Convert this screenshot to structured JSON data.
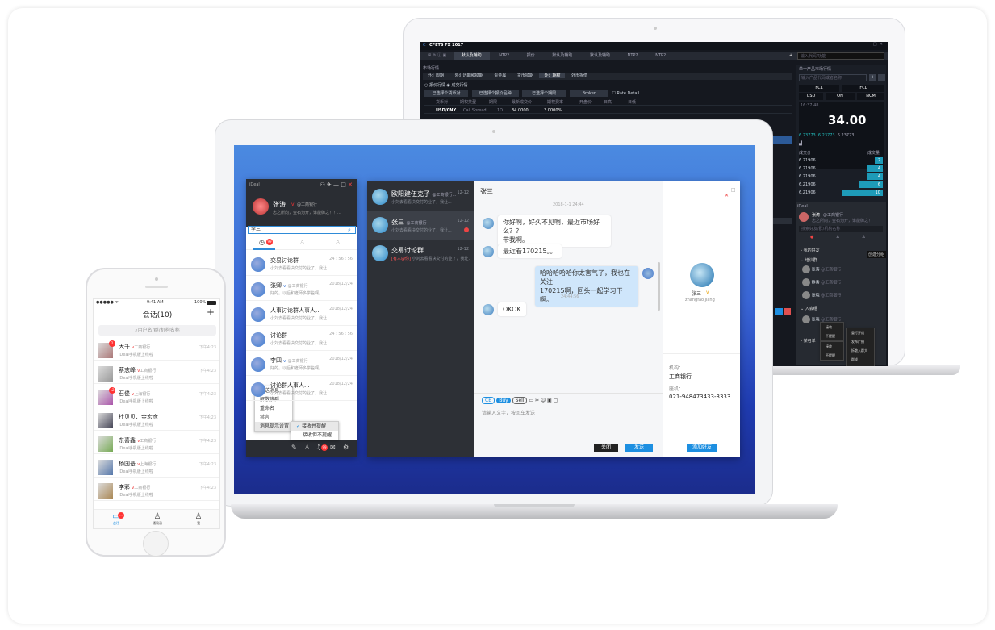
{
  "monitor": {
    "app_title": "CFETS FX 2017",
    "tabs": [
      "默认及辅助",
      "NTP2",
      "报价",
      "默认及辅助",
      "默认及辅助",
      "NTP2",
      "NTP2"
    ],
    "search_placeholder": "输入代码/功能",
    "panel_title": "市场行情",
    "sub_tabs": [
      "外汇即期",
      "外汇远期和掉期",
      "贵金属",
      "货币掉期",
      "外汇期权",
      "外币拆借"
    ],
    "radio1": "报价行情",
    "radio2": "成交行情",
    "filters": [
      "已选择个货币对",
      "已选择个报价品种",
      "已选择个期限",
      "Broker",
      "Rate Detail"
    ],
    "col_headers": [
      "货币对",
      "期权类型",
      "期限",
      "最新成交价",
      "期权费率",
      "开盘价",
      "日高",
      "日低"
    ],
    "row1": [
      "USD/CNY",
      "Call Spread",
      "1D",
      "34.0000",
      "3.0000%"
    ],
    "right_title": "单一产品市场行情",
    "right_search": "输入产品代码或者名称",
    "fcl": "FCL",
    "fcl2": "FCL",
    "usd": "USD",
    "on": "ON",
    "ncm": "NCM",
    "time": "16:37:48",
    "price": "34.00",
    "lo": "6.23773",
    "mid": "6.23773",
    "hi": "6.23773",
    "deal_price": "成交价",
    "deal_vol": "成交量",
    "orders": [
      {
        "p": "6.21906",
        "q": "2",
        "w": 0.2
      },
      {
        "p": "6.21906",
        "q": "4",
        "w": 0.4
      },
      {
        "p": "6.21906",
        "q": "4",
        "w": 0.4
      },
      {
        "p": "6.21906",
        "q": "6",
        "w": 0.6
      },
      {
        "p": "6.21906",
        "q": "10",
        "w": 1.0
      }
    ],
    "mini_name": "张涛",
    "mini_org": "@工商银行",
    "mini_sign": "志之所向，金石为开，谁能御之！",
    "mini_search": "搜索好友/群/机构名称",
    "mini_groups": [
      "我的好友",
      "培训群",
      "入会组",
      "某名单"
    ],
    "mini_items": [
      {
        "n": "张涛",
        "o": "@工商银行"
      },
      {
        "n": "静香",
        "o": "@工商银行"
      },
      {
        "n": "张晓",
        "o": "@工商银行"
      },
      {
        "n": "张晓",
        "o": "@工商银行"
      }
    ],
    "mini_tip": "创建分组",
    "mini_menu1": [
      "接收",
      "不提醒"
    ],
    "mini_menu2": [
      "接收",
      "不提醒"
    ],
    "mini_menu3": [
      "重打开组",
      "发布广播",
      "拆散入群大",
      "群成",
      "退出"
    ]
  },
  "ideal": {
    "title": "iDeal",
    "name": "张涛",
    "org": "@工商银行",
    "sign": "志之所向，金石为开，谁能御之！！...",
    "search": "李三",
    "badge": "99",
    "chats": [
      {
        "name": "交易讨论群",
        "msg": "小刘去看看决交付的业了，我让...",
        "time": "24 : 56 : 56"
      },
      {
        "name": "张卿",
        "org": "@工商银行",
        "msg": "好的。以后和老师多学些啊。",
        "time": "2018/12/24"
      },
      {
        "name": "人事讨论群人事人...",
        "msg": "小刘去看看决交付的业了，我让...",
        "time": "2018/12/24"
      },
      {
        "name": "讨论群",
        "msg": "小刘去看看决交付的业了，我让...",
        "time": "24 : 56 : 56"
      },
      {
        "name": "李四",
        "org": "@工商银行",
        "msg": "好的。以后和老师多学些啊。",
        "time": "2018/12/24"
      },
      {
        "name": "讨论群人事人...",
        "msg": "小刘去看看决交付的业了，我让...",
        "time": "2018/12/24"
      }
    ],
    "menu": [
      "发送消息",
      "解散该群",
      "重命名",
      "禁言",
      "消息提示设置"
    ],
    "submenu": [
      "接收并提醒",
      "接收但不提醒"
    ],
    "bottom_badge": "99"
  },
  "chat": {
    "list": [
      {
        "name": "欧阳建伍克子",
        "org": "@工商银行...",
        "msg": "小刘去看看决交付的业了，我让...",
        "time": "12-12"
      },
      {
        "name": "张三",
        "org": "@工商银行",
        "msg": "小刘去看看决交付的业了，我让...",
        "time": "12-12"
      },
      {
        "name": "交易讨论群",
        "msg": "小刘去看看决交付的业了，我让...",
        "tag": "[有人@你]",
        "time": "12-12"
      }
    ],
    "title": "张三",
    "date": "2018-1-1 24:44",
    "m1": "你好啊，好久不见啊，最近市场好么？？",
    "m1b": "带我啊。",
    "m2": "最近看170215。。",
    "m3": "哈哈哈哈哈你太害气了，我也在关注",
    "m3b": "170215啊，回头一起学习下啊。",
    "time2": "24:44:56",
    "m4": "OKOK",
    "tools": [
      "CB",
      "Buy",
      "Sell"
    ],
    "input_placeholder": "请输入文字，按回车发送",
    "close": "关闭",
    "send": "发送",
    "profile_name": "张三",
    "profile_id": "zhangfao.jiang",
    "org_label": "机构：",
    "org": "工商银行",
    "phone_label": "座机：",
    "phone": "021-948473433-3333",
    "add": "添加好友"
  },
  "phone": {
    "status_time": "9:41 AM",
    "battery": "100%",
    "title": "会话(10)",
    "plus": "+",
    "search": "用户名/群/机构名称",
    "rows": [
      {
        "name": "大千",
        "org": "工商银行",
        "msg": "iDeal手机版上线啦",
        "time": "下午4:23",
        "badge": "2"
      },
      {
        "name": "蔡志峰",
        "org": "工商银行",
        "msg": "iDeal手机版上线啦",
        "time": "下午4:23"
      },
      {
        "name": "石俊",
        "org": "上海银行",
        "msg": "iDeal手机版上线啦",
        "time": "下午4:23",
        "badge": "12"
      },
      {
        "name": "杜贝贝、金宏彦",
        "org": "",
        "msg": "iDeal手机版上线啦",
        "time": "下午4:23"
      },
      {
        "name": "东喜鑫",
        "org": "工商银行",
        "msg": "iDeal手机版上线啦",
        "time": "下午4:23"
      },
      {
        "name": "杨国基",
        "org": "上海银行",
        "msg": "iDeal手机版上线啦",
        "time": "下午4:23"
      },
      {
        "name": "李彩",
        "org": "工商银行",
        "msg": "iDeal手机版上线啦",
        "time": "下午4:23"
      }
    ],
    "tabs": [
      "会话",
      "通讯录",
      "我"
    ],
    "tab_badge": "..."
  },
  "colors": {
    "accent": "#1d8fe1",
    "dark": "#2d3036",
    "teal": "#1e9bb8"
  }
}
